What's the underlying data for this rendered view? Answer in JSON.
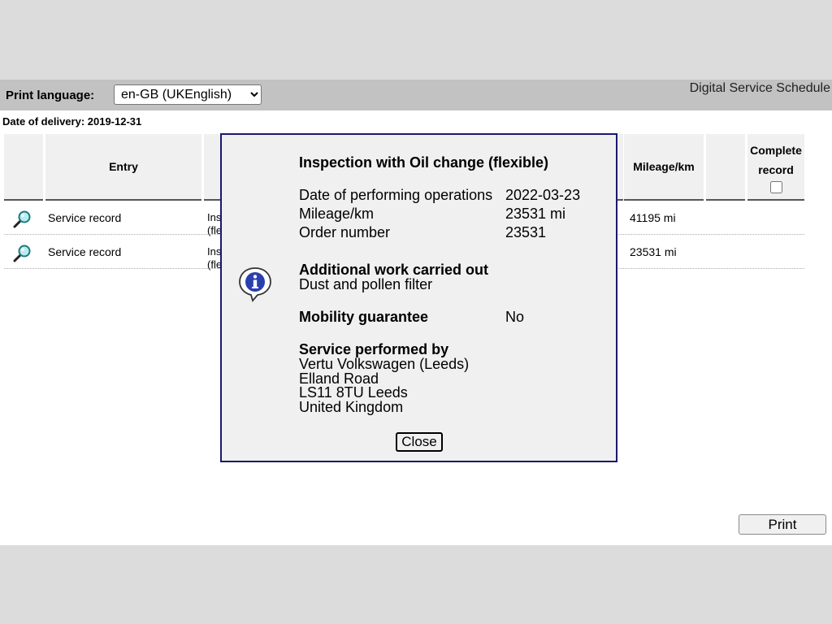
{
  "toolbar": {
    "print_language_label": "Print language:",
    "print_language_value": "en-GB (UKEnglish)",
    "app_title": "Digital Service Schedule"
  },
  "delivery": "Date of delivery: 2019-12-31",
  "table": {
    "headers": {
      "entry": "Entry",
      "mileage": "Mileage/km",
      "complete_line1": "Complete",
      "complete_line2": "record"
    },
    "rows": [
      {
        "entry": "Service record",
        "desc_line1": "Ins",
        "desc_line2": "(fle",
        "mileage": "41195 mi"
      },
      {
        "entry": "Service record",
        "desc_line1": "Ins",
        "desc_line2": "(fle",
        "mileage": "23531 mi"
      }
    ]
  },
  "print_button": "Print",
  "modal": {
    "title": "Inspection with Oil change (flexible)",
    "date_label": "Date of performing operations",
    "date_value": "2022-03-23",
    "mileage_label": "Mileage/km",
    "mileage_value": "23531 mi",
    "order_label": "Order number",
    "order_value": "23531",
    "additional_heading": "Additional work carried out",
    "additional_value": "Dust and pollen filter",
    "mobility_label": "Mobility guarantee",
    "mobility_value": "No",
    "service_heading": "Service performed by",
    "address": [
      "Vertu Volkswagen (Leeds)",
      "Elland Road",
      "LS11 8TU Leeds",
      "United Kingdom"
    ],
    "close_label": "Close",
    "icon": "info-speech-bubble-icon"
  },
  "colors": {
    "modal_border": "#1a1a6e",
    "toolbar_bg": "#c2c2c2",
    "header_bg": "#f0f0f0"
  }
}
